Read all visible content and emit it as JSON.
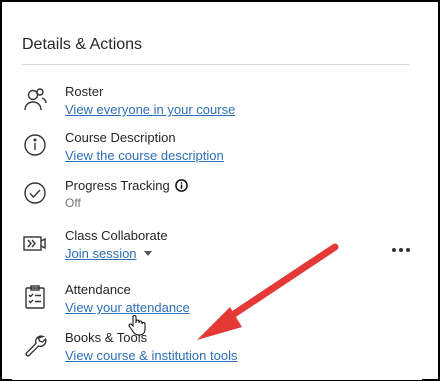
{
  "section_title": "Details & Actions",
  "items": [
    {
      "label": "Roster",
      "link": "View everyone in your course",
      "icon": "roster-icon"
    },
    {
      "label": "Course Description",
      "link": "View the course description",
      "icon": "info-icon"
    },
    {
      "label": "Progress Tracking",
      "sub": "Off",
      "icon": "progress-check-icon"
    },
    {
      "label": "Class Collaborate",
      "link": "Join session",
      "icon": "collaborate-icon"
    },
    {
      "label": "Attendance",
      "link": "View your attendance",
      "icon": "attendance-icon"
    },
    {
      "label": "Books & Tools",
      "link": "View course & institution tools",
      "icon": "wrench-icon"
    }
  ],
  "colors": {
    "link": "#2d6fb6",
    "annotation_arrow": "#e53935"
  }
}
